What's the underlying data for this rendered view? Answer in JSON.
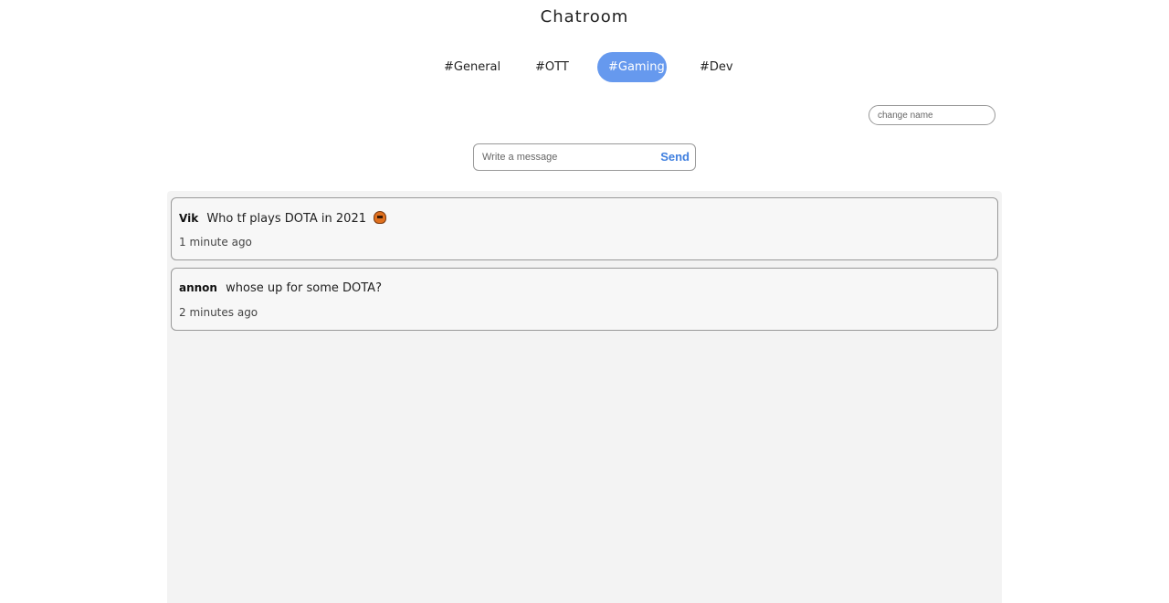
{
  "header": {
    "title": "Chatroom"
  },
  "tabs": [
    {
      "label": "#General",
      "active": false
    },
    {
      "label": "#OTT",
      "active": false
    },
    {
      "label": "#Gaming",
      "active": true
    },
    {
      "label": "#Dev",
      "active": false
    }
  ],
  "name_field": {
    "placeholder": "change name",
    "value": ""
  },
  "composer": {
    "placeholder": "Write a message",
    "value": "",
    "send_label": "Send"
  },
  "messages": [
    {
      "author": "Vik",
      "text": "Who tf plays DOTA in 2021",
      "emoji": "angry-pixel-face",
      "time": "1 minute ago"
    },
    {
      "author": "annon",
      "text": "whose up for some DOTA?",
      "time": "2 minutes ago"
    }
  ],
  "colors": {
    "accent": "#6699ee",
    "send": "#3f7fdf",
    "feed_bg": "#f3f3f3"
  }
}
